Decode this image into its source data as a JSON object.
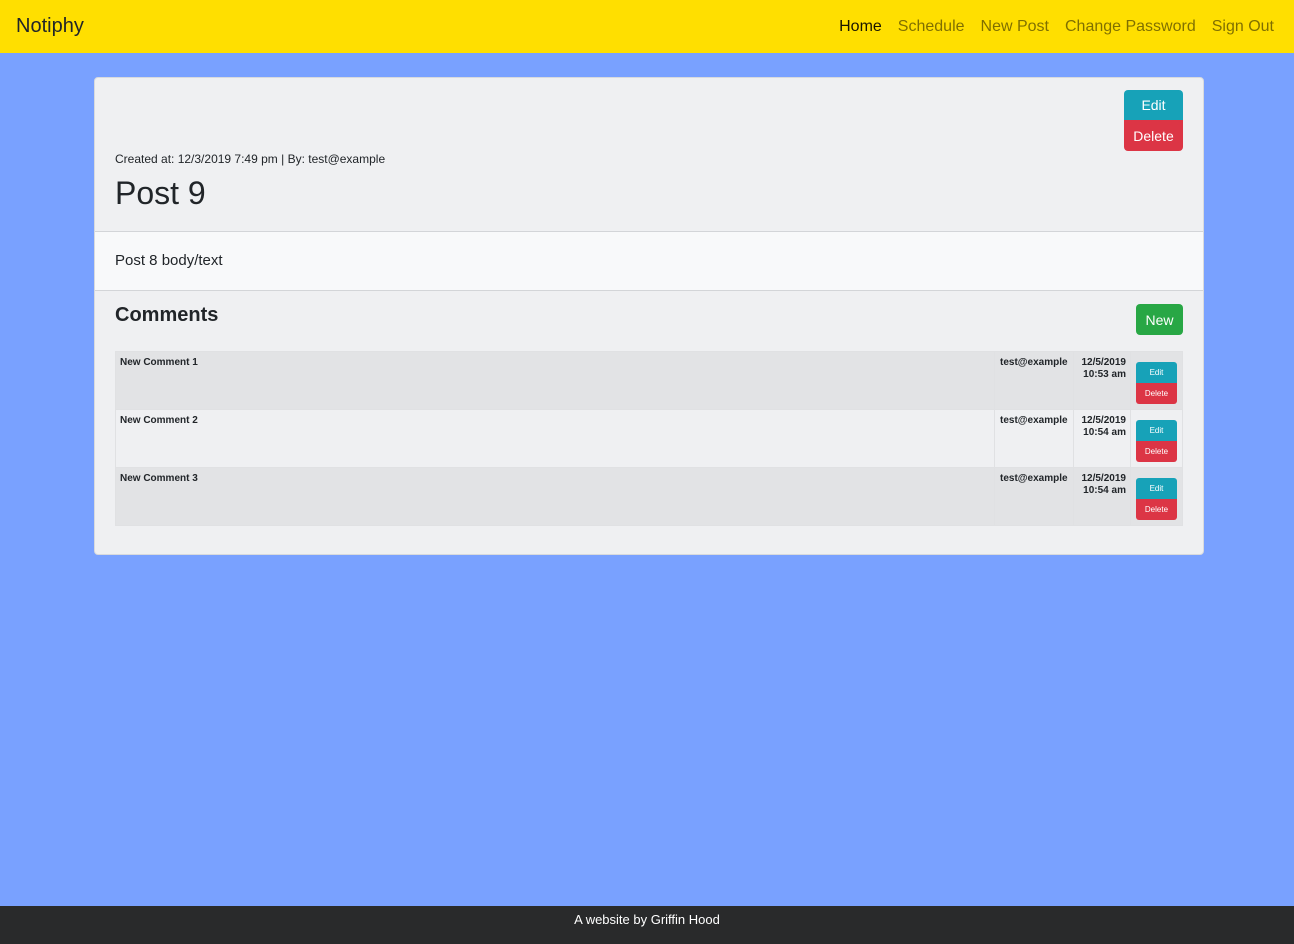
{
  "navbar": {
    "brand": "Notiphy",
    "links": [
      {
        "label": "Home",
        "active": true
      },
      {
        "label": "Schedule",
        "active": false
      },
      {
        "label": "New Post",
        "active": false
      },
      {
        "label": "Change Password",
        "active": false
      },
      {
        "label": "Sign Out",
        "active": false
      }
    ]
  },
  "post": {
    "meta": "Created at: 12/3/2019 7:49 pm | By: test@example",
    "title": "Post 9",
    "body": "Post 8 body/text",
    "edit_label": "Edit",
    "delete_label": "Delete"
  },
  "comments": {
    "heading": "Comments",
    "new_label": "New",
    "edit_label": "Edit",
    "delete_label": "Delete",
    "rows": [
      {
        "body": "New Comment 1",
        "author": "test@example",
        "date": "12/5/2019",
        "time": "10:53 am"
      },
      {
        "body": "New Comment 2",
        "author": "test@example",
        "date": "12/5/2019",
        "time": "10:54 am"
      },
      {
        "body": "New Comment 3",
        "author": "test@example",
        "date": "12/5/2019",
        "time": "10:54 am"
      }
    ]
  },
  "footer": {
    "text": "A website by Griffin Hood"
  },
  "colors": {
    "navbar": "#ffdf00",
    "background": "#79a1ff",
    "edit": "#17a2b8",
    "delete": "#dc3545",
    "new": "#28a745",
    "footer": "#292a2b"
  }
}
